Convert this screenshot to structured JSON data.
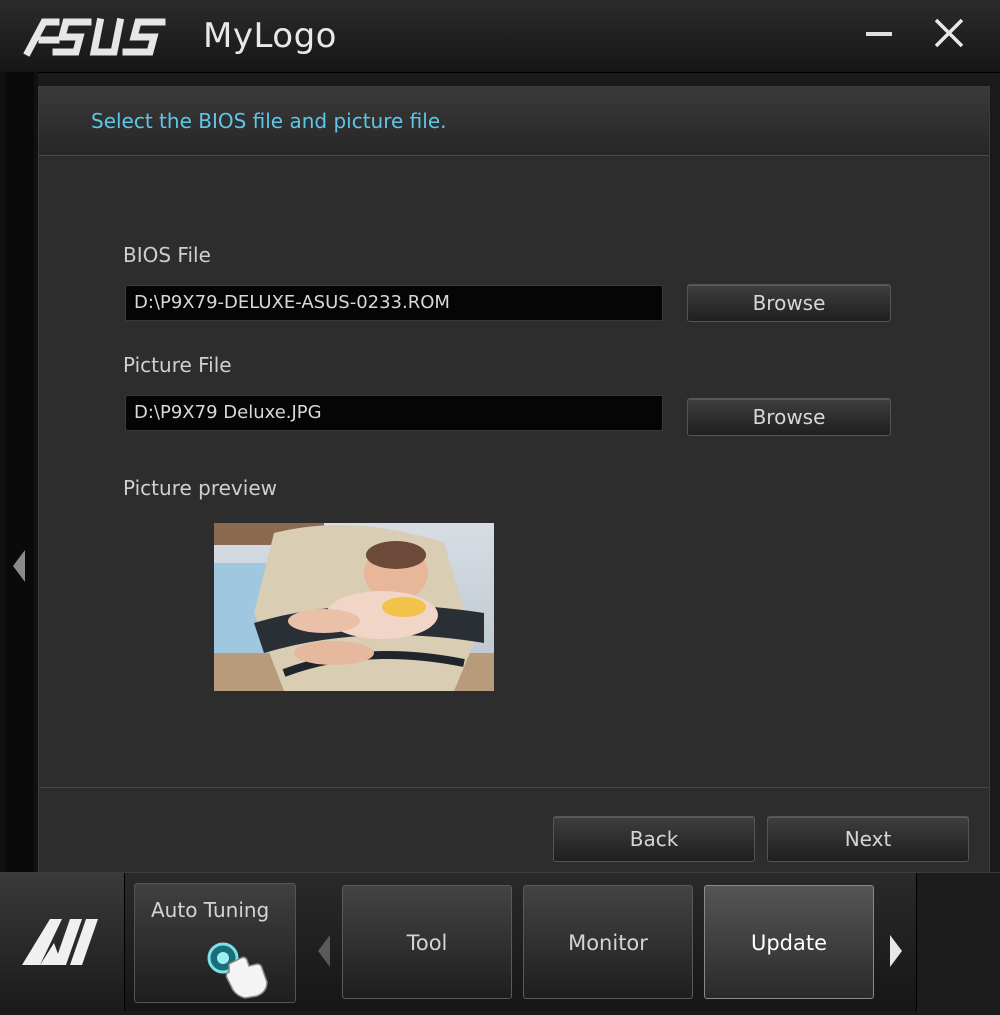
{
  "window": {
    "brand": "ASUS",
    "title": "MyLogo"
  },
  "panel": {
    "instruction": "Select the BIOS file and picture file.",
    "bios": {
      "label": "BIOS File",
      "value": "D:\\P9X79-DELUXE-ASUS-0233.ROM",
      "browse_label": "Browse"
    },
    "picture": {
      "label": "Picture File",
      "value": "D:\\P9X79 Deluxe.JPG",
      "browse_label": "Browse"
    },
    "preview_label": "Picture preview",
    "back_label": "Back",
    "next_label": "Next"
  },
  "dock": {
    "logo": "AI",
    "auto_tuning": "Auto Tuning",
    "items": [
      {
        "label": "Tool"
      },
      {
        "label": "Monitor"
      },
      {
        "label": "Update",
        "active": true
      }
    ]
  },
  "colors": {
    "accent": "#5fc6e8",
    "background": "#2d2d2d"
  }
}
